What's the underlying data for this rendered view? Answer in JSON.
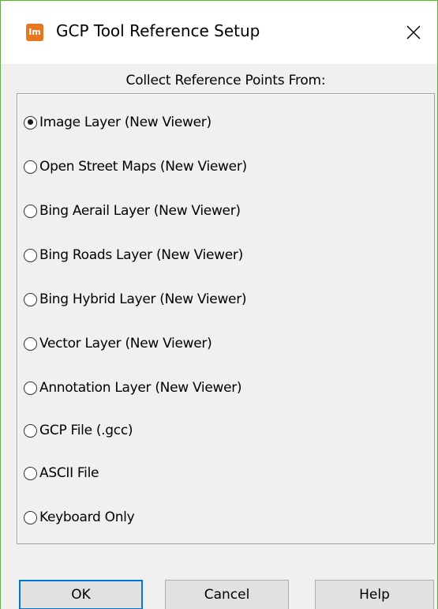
{
  "window": {
    "title": "GCP Tool Reference Setup",
    "app_icon_text": "Im",
    "close_glyph": "close-icon"
  },
  "group": {
    "label": "Collect Reference Points From:"
  },
  "options": [
    {
      "label": "Image Layer (New Viewer)",
      "checked": true
    },
    {
      "label": "Open Street Maps (New Viewer)",
      "checked": false
    },
    {
      "label": "Bing Aerail Layer (New Viewer)",
      "checked": false
    },
    {
      "label": "Bing Roads Layer (New Viewer)",
      "checked": false
    },
    {
      "label": "Bing Hybrid Layer (New Viewer)",
      "checked": false
    },
    {
      "label": "Vector Layer (New Viewer)",
      "checked": false
    },
    {
      "label": "Annotation Layer (New Viewer)",
      "checked": false
    },
    {
      "label": "GCP File (.gcc)",
      "checked": false
    },
    {
      "label": "ASCII File",
      "checked": false
    },
    {
      "label": "Keyboard Only",
      "checked": false
    }
  ],
  "buttons": {
    "ok": "OK",
    "cancel": "Cancel",
    "help": "Help"
  },
  "colors": {
    "accent": "#0078d7",
    "app_icon": "#e87722",
    "window_border": "#6aa84f"
  }
}
